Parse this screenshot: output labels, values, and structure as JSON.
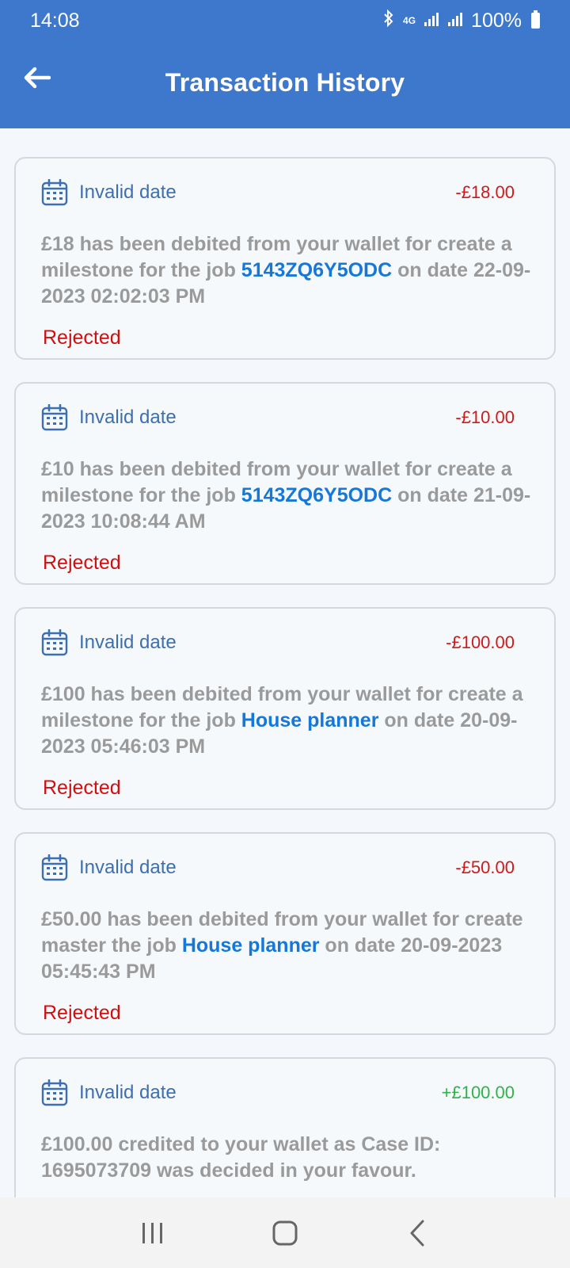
{
  "status_bar": {
    "time": "14:08",
    "network": "4G",
    "battery": "100%"
  },
  "app_bar": {
    "title": "Transaction History"
  },
  "transactions": [
    {
      "date": "Invalid date",
      "amount": "-£18.00",
      "type": "debit",
      "pre": "£18 has been debited from your wallet for create a milestone for the job ",
      "job": "5143ZQ6Y5ODC",
      "post": " on date 22-09-2023 02:02:03 PM",
      "status": "Rejected"
    },
    {
      "date": "Invalid date",
      "amount": "-£10.00",
      "type": "debit",
      "pre": "£10 has been debited from your wallet for create a milestone for the job ",
      "job": "5143ZQ6Y5ODC",
      "post": " on date 21-09-2023 10:08:44 AM",
      "status": "Rejected"
    },
    {
      "date": "Invalid date",
      "amount": "-£100.00",
      "type": "debit",
      "pre": "£100 has been debited from your wallet for create a milestone for the job ",
      "job": "House planner",
      "post": " on date 20-09-2023 05:46:03 PM",
      "status": "Rejected"
    },
    {
      "date": "Invalid date",
      "amount": "-£50.00",
      "type": "debit",
      "pre": "£50.00 has been debited from your wallet for create master the job ",
      "job": "House planner",
      "post": " on date 20-09-2023 05:45:43 PM",
      "status": "Rejected"
    },
    {
      "date": "Invalid date",
      "amount": "+£100.00",
      "type": "credit",
      "pre": "£100.00 credited to your wallet as Case ID: 1695073709 was decided in your favour.",
      "job": "",
      "post": "",
      "status": ""
    }
  ],
  "colors": {
    "primary": "#3d78cc",
    "debit": "#cc1b1b",
    "credit": "#2fb24a",
    "job_link": "#1577d8",
    "rejected": "#d10f0f"
  }
}
